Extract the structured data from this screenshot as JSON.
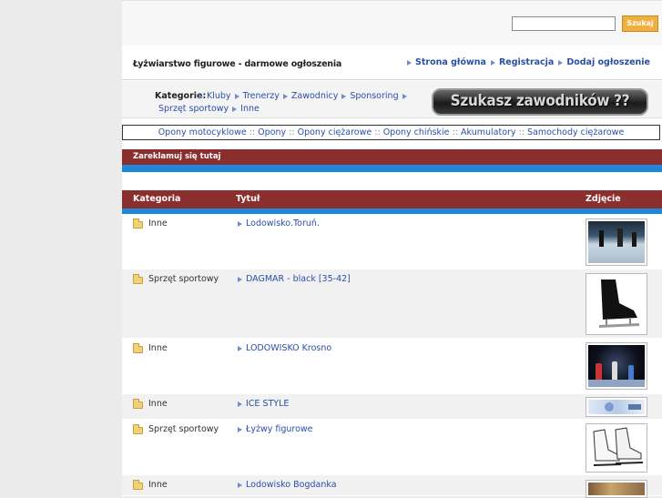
{
  "search": {
    "input_value": "",
    "button_label": "Szukaj"
  },
  "header": {
    "site_title": "Łyżwiarstwo figurowe - darmowe ogłoszenia",
    "nav": [
      "Strona główna",
      "Registracja",
      "Dodaj ogłoszenie"
    ]
  },
  "categories": {
    "label": "Kategorie:",
    "line1": [
      "Kluby",
      "Trenerzy",
      "Zawodnicy",
      "Sponsoring"
    ],
    "line2": [
      "Sprzęt sportowy",
      "Inne"
    ]
  },
  "banner": {
    "text": "Szukasz zawodników ??"
  },
  "links": [
    "Opony motocyklowe",
    "Opony",
    "Opony ciężarowe",
    "Opony chińskie",
    "Akumulatory",
    "Samochody ciężarowe"
  ],
  "links_separator": "::",
  "advert": {
    "label": "Zareklamuj się tutaj"
  },
  "table": {
    "headers": {
      "category": "Kategoria",
      "title": "Tytuł",
      "photo": "Zdjęcie"
    },
    "rows": [
      {
        "category": "Inne",
        "title": "Lodowisko.Toruń.",
        "photo": "rink-photo"
      },
      {
        "category": "Sprzęt sportowy",
        "title": "DAGMAR - black [35-42]",
        "photo": "black-skate-photo"
      },
      {
        "category": "Inne",
        "title": "LODOWISKO Krosno",
        "photo": "rink-night-photo"
      },
      {
        "category": "Inne",
        "title": "ICE STYLE",
        "photo": "ice-style-photo"
      },
      {
        "category": "Sprzęt sportowy",
        "title": "Łyżwy figurowe",
        "photo": "white-skates-photo"
      },
      {
        "category": "Inne",
        "title": "Lodowisko Bogdanka",
        "photo": "rink-photo"
      }
    ]
  },
  "colors": {
    "accent_red": "#8b2e2e",
    "accent_blue": "#1e87d8",
    "link": "#2a4fa8",
    "button": "#f0b040"
  }
}
